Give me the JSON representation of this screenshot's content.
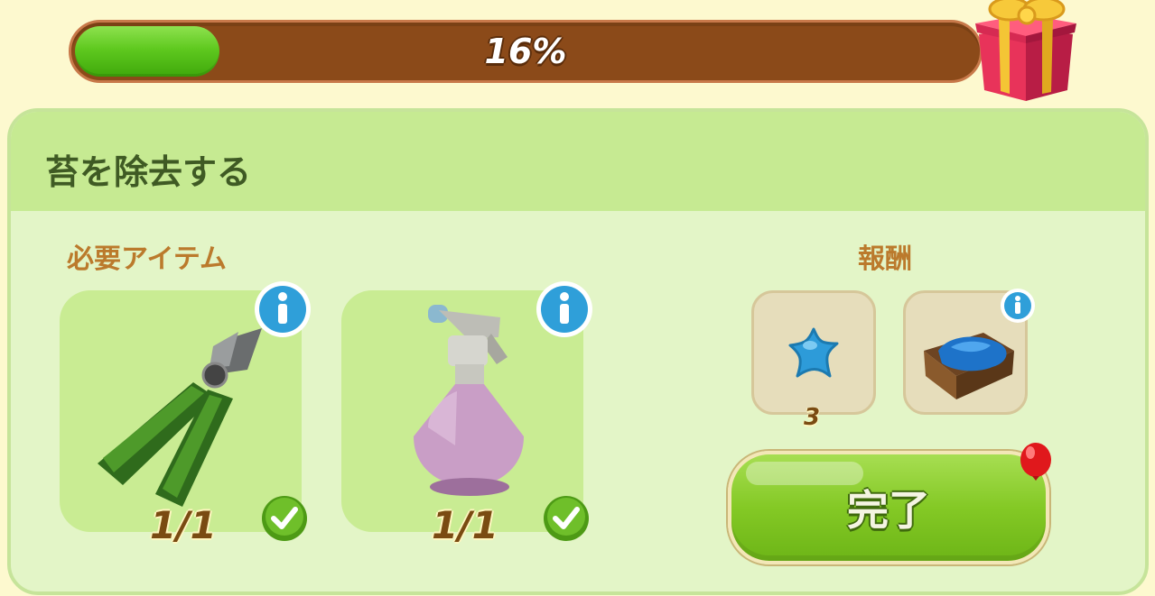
{
  "progress": {
    "percent_label": "16%",
    "value_percent": 16
  },
  "task": {
    "title": "苔を除去する",
    "required_label": "必要アイテム",
    "reward_label": "報酬",
    "complete_label": "完了"
  },
  "required_items": [
    {
      "icon": "pruning-shears-icon",
      "count": "1/1",
      "fulfilled": true
    },
    {
      "icon": "spray-bottle-icon",
      "count": "1/1",
      "fulfilled": true
    }
  ],
  "rewards": [
    {
      "icon": "blue-star-icon",
      "count": "3"
    },
    {
      "icon": "crate-of-blue-cloth-icon",
      "count": ""
    }
  ],
  "colors": {
    "progress_track": "#8b4a19",
    "progress_fill": "#5fc91f",
    "panel_bg": "#e3f5c7",
    "header_bg": "#c6ea92",
    "button_green": "#84c925",
    "info_blue": "#2f9fd9",
    "check_green": "#5fae1c"
  }
}
